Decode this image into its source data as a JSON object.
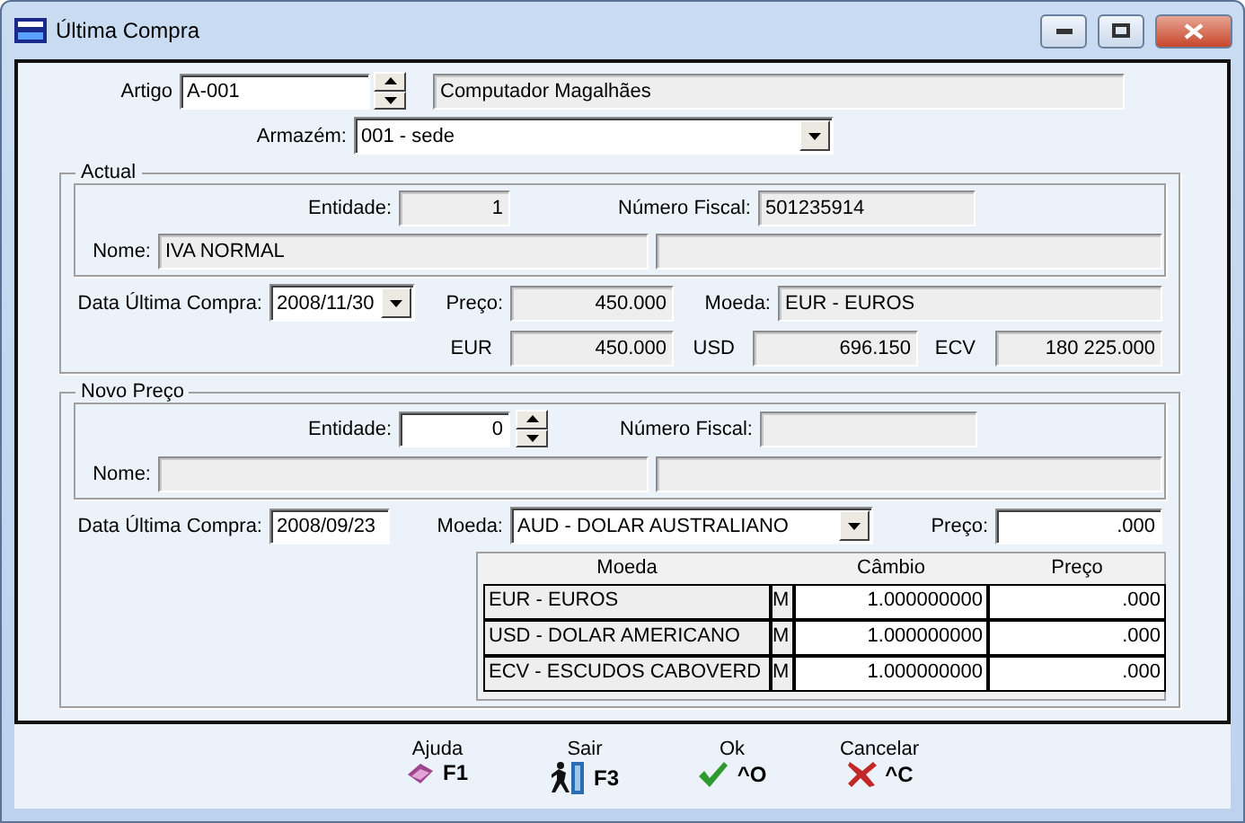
{
  "window": {
    "title": "Última Compra"
  },
  "article": {
    "label": "Artigo",
    "code": "A-001",
    "description": "Computador Magalhães"
  },
  "warehouse": {
    "label": "Armazém:",
    "value": "001 - sede"
  },
  "current": {
    "title": "Actual",
    "entity_label": "Entidade:",
    "entity": "1",
    "tax_number_label": "Número Fiscal:",
    "tax_number": "501235914",
    "name_label": "Nome:",
    "name": "IVA NORMAL",
    "date_label": "Data Última Compra:",
    "date": "2008/11/30",
    "price_label": "Preço:",
    "price": "450.000",
    "currency_label": "Moeda:",
    "currency": "EUR - EUROS",
    "conversions": [
      {
        "label": "EUR",
        "value": "450.000"
      },
      {
        "label": "USD",
        "value": "696.150"
      },
      {
        "label": "ECV",
        "value": "180 225.000"
      }
    ]
  },
  "new_price": {
    "title": "Novo Preço",
    "entity_label": "Entidade:",
    "entity": "0",
    "tax_number_label": "Número Fiscal:",
    "name_label": "Nome:",
    "date_label": "Data Última Compra:",
    "date": "2008/09/23",
    "currency_label": "Moeda:",
    "currency": "AUD - DOLAR AUSTRALIANO",
    "price_label": "Preço:",
    "price": ".000",
    "table": {
      "columns": [
        "Moeda",
        "Câmbio",
        "Preço"
      ],
      "rows": [
        {
          "currency": "EUR - EUROS",
          "flag": "M",
          "rate": "1.000000000",
          "price": ".000"
        },
        {
          "currency": "USD - DOLAR AMERICANO",
          "flag": "M",
          "rate": "1.000000000",
          "price": ".000"
        },
        {
          "currency": "ECV - ESCUDOS CABOVERD",
          "flag": "M",
          "rate": "1.000000000",
          "price": ".000"
        }
      ]
    }
  },
  "toolbar": [
    {
      "kind": "help",
      "label": "Ajuda",
      "key": "F1"
    },
    {
      "kind": "exit",
      "label": "Sair",
      "key": "F3"
    },
    {
      "kind": "ok",
      "label": "Ok",
      "key": "^O"
    },
    {
      "kind": "cancel",
      "label": "Cancelar",
      "key": "^C"
    }
  ]
}
